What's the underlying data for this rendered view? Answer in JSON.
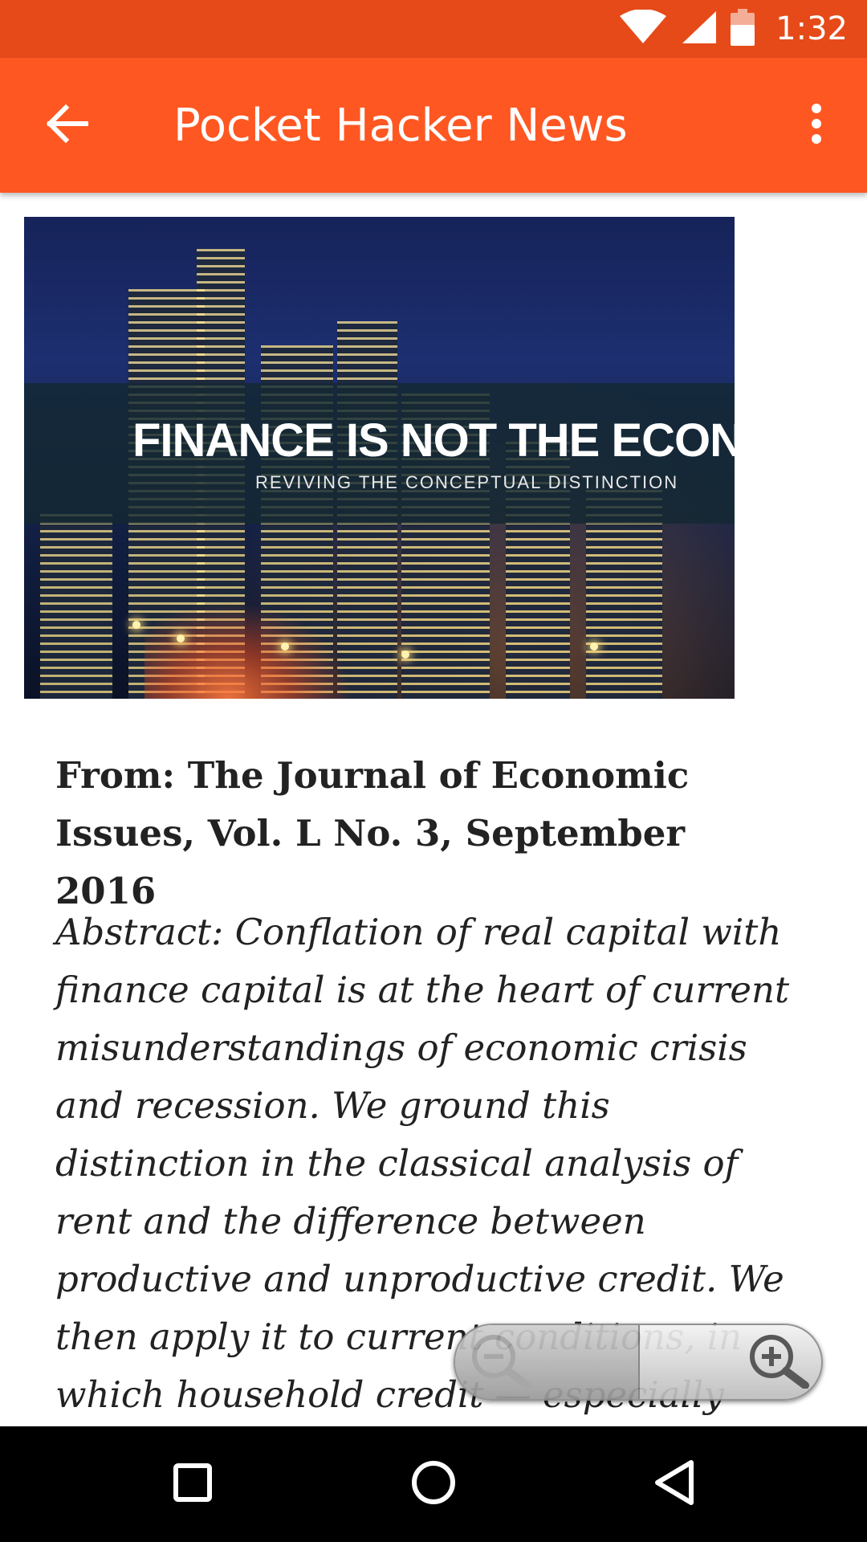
{
  "status_bar": {
    "time": "1:32",
    "icons": [
      "wifi-icon",
      "cell-signal-icon",
      "battery-icon"
    ]
  },
  "app_bar": {
    "title": "Pocket Hacker News",
    "back_icon": "arrow-back-icon",
    "overflow_icon": "more-vert-icon"
  },
  "article": {
    "hero_image": {
      "title": "FINANCE IS NOT THE ECONOM",
      "subtitle": "REVIVING THE CONCEPTUAL DISTINCTION"
    },
    "source": "From: The Journal of Economic Issues, Vol. L No. 3, September 2016",
    "abstract": "Abstract: Conflation of real capital with finance capital is at the heart of current misunderstandings of economic crisis and recession. We ground this distinction in the classical analysis of rent and the difference between productive and unproductive credit. We then apply it to current conditions, in which household credit — especially"
  },
  "zoom_control": {
    "zoom_out_icon": "zoom-out-icon",
    "zoom_in_icon": "zoom-in-icon"
  },
  "nav_bar": {
    "recents_icon": "recents-square-icon",
    "home_icon": "home-circle-icon",
    "back_icon": "back-triangle-icon"
  },
  "colors": {
    "status_bar": "#e64a19",
    "app_bar": "#ff5722",
    "text": "#222222",
    "nav_bar": "#000000"
  }
}
